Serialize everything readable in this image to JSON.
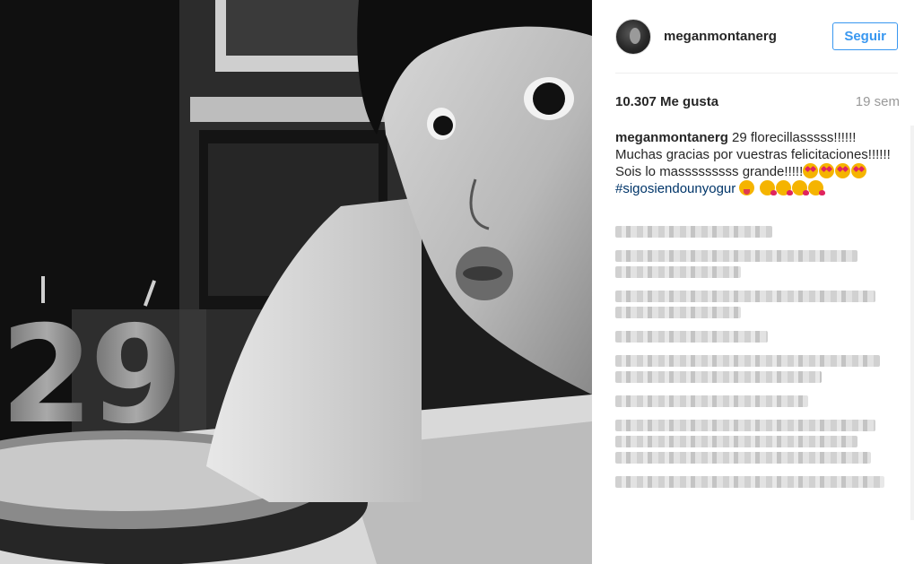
{
  "post": {
    "username": "meganmontanerg",
    "follow_label": "Seguir",
    "likes": "10.307 Me gusta",
    "time_ago": "19 sem",
    "caption_user": "meganmontanerg",
    "caption_text_1": " 29 florecillasssss!!!!!! Muchas gracias por vuestras felicitaciones!!!!!! Sois lo masssssssss grande!!!!!",
    "hashtag": "#sigosiendounyogur",
    "emojis": [
      "heart-eyes-emoji",
      "heart-eyes-emoji",
      "heart-eyes-emoji",
      "heart-eyes-emoji",
      "tongue-emoji",
      "kiss-emoji",
      "kiss-emoji",
      "kiss-emoji",
      "kiss-emoji"
    ]
  },
  "colors": {
    "accent": "#3897f0",
    "hashtag": "#003569",
    "muted": "#999999"
  }
}
